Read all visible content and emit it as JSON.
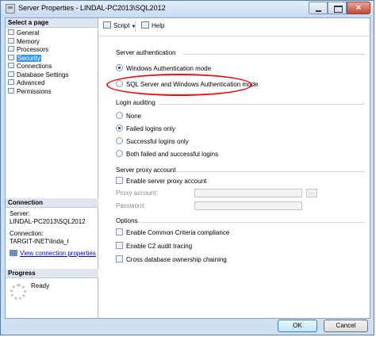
{
  "window": {
    "title": "Server Properties - LINDAL-PC2013\\SQL2012",
    "close_glyph": "×"
  },
  "left_panel": {
    "select_page_label": "Select a page",
    "pages": [
      {
        "label": "General",
        "selected": false
      },
      {
        "label": "Memory",
        "selected": false
      },
      {
        "label": "Processors",
        "selected": false
      },
      {
        "label": "Security",
        "selected": true
      },
      {
        "label": "Connections",
        "selected": false
      },
      {
        "label": "Database Settings",
        "selected": false
      },
      {
        "label": "Advanced",
        "selected": false
      },
      {
        "label": "Permissions",
        "selected": false
      }
    ],
    "connection": {
      "header": "Connection",
      "server_label": "Server:",
      "server_value": "LINDAL-PC2013\\SQL2012",
      "connection_label": "Connection:",
      "connection_value": "TARGIT-INET\\linda_l",
      "view_link": "View connection properties"
    },
    "progress": {
      "header": "Progress",
      "status": "Ready"
    }
  },
  "toolbar": {
    "script_label": "Script",
    "help_label": "Help"
  },
  "server_authentication": {
    "label": "Server authentication",
    "options": [
      {
        "label": "Windows Authentication mode",
        "selected": true
      },
      {
        "label": "SQL Server and Windows Authentication mode",
        "selected": false
      }
    ]
  },
  "login_auditing": {
    "label": "Login auditing",
    "options": [
      {
        "label": "None",
        "selected": false
      },
      {
        "label": "Failed logins only",
        "selected": true
      },
      {
        "label": "Successful logins only",
        "selected": false
      },
      {
        "label": "Both failed and successful logins",
        "selected": false
      }
    ]
  },
  "server_proxy": {
    "label": "Server proxy account",
    "enable_label": "Enable server proxy account",
    "enabled": false,
    "proxy_account_label": "Proxy account:",
    "proxy_account_value": "",
    "password_label": "Password:",
    "password_value": "",
    "browse_label": "..."
  },
  "options": {
    "label": "Options",
    "items": [
      {
        "label": "Enable Common Criteria compliance",
        "checked": false
      },
      {
        "label": "Enable C2 audit tracing",
        "checked": false
      },
      {
        "label": "Cross database ownership chaining",
        "checked": false
      }
    ]
  },
  "buttons": {
    "ok": "OK",
    "cancel": "Cancel"
  },
  "annotation": {
    "color": "#e3101a"
  },
  "colors": {
    "selection": "#3399ff",
    "link": "#0000cc",
    "window_frame": "#cfe0f3"
  }
}
